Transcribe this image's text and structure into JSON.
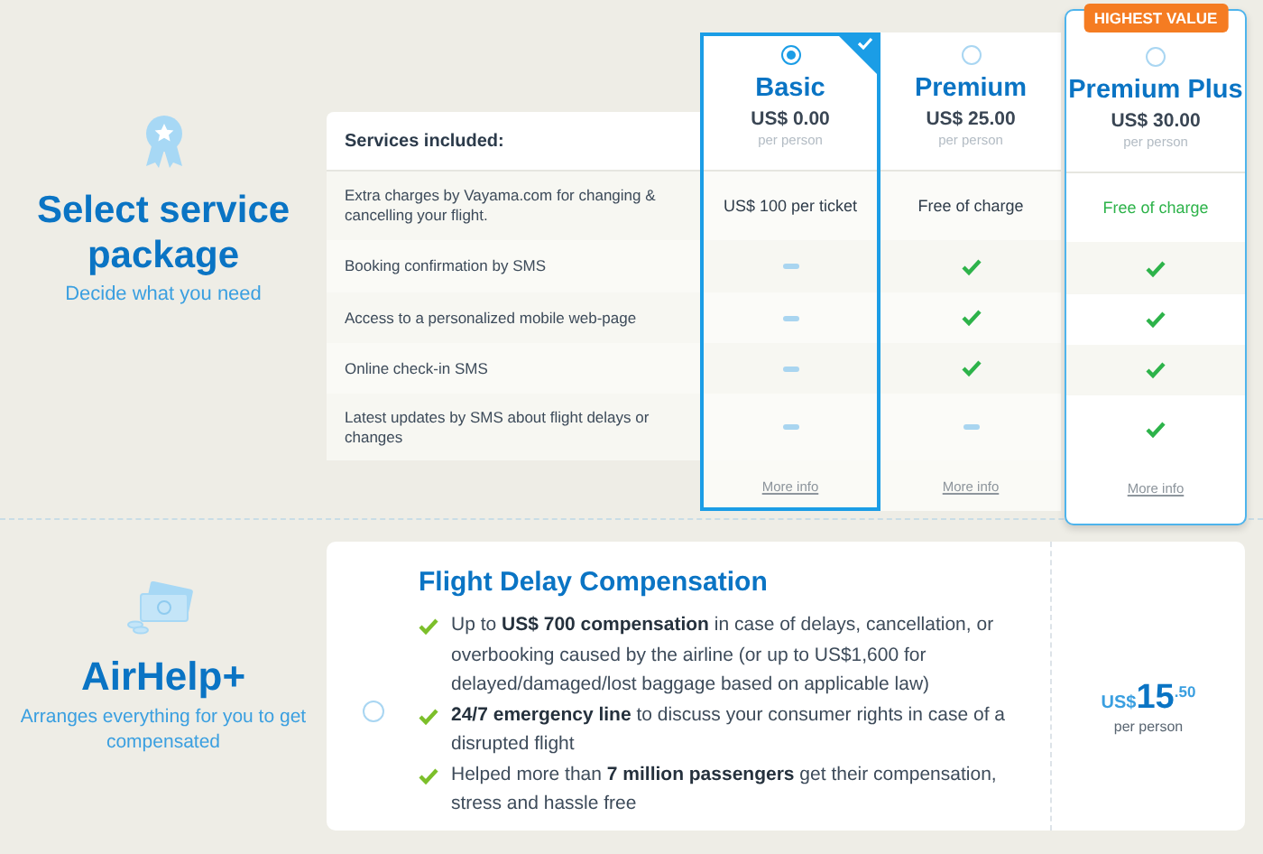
{
  "intro": {
    "title": "Select service package",
    "subtitle": "Decide what you need"
  },
  "services": {
    "heading": "Services included:",
    "rows": [
      "Extra charges by Vayama.com for changing & cancelling your flight.",
      "Booking confirmation by SMS",
      "Access to a personalized mobile web-page",
      "Online check-in SMS",
      "Latest updates by SMS about flight delays or changes"
    ]
  },
  "plans": [
    {
      "name": "Basic",
      "price": "US$ 0.00",
      "per": "per person",
      "selected": true,
      "more": "More info",
      "cells": [
        {
          "kind": "text",
          "text": "US$ 100 per ticket"
        },
        {
          "kind": "dash"
        },
        {
          "kind": "dash"
        },
        {
          "kind": "dash"
        },
        {
          "kind": "dash"
        }
      ]
    },
    {
      "name": "Premium",
      "price": "US$ 25.00",
      "per": "per person",
      "selected": false,
      "more": "More info",
      "cells": [
        {
          "kind": "text",
          "text": "Free of charge"
        },
        {
          "kind": "check"
        },
        {
          "kind": "check"
        },
        {
          "kind": "check"
        },
        {
          "kind": "dash"
        }
      ]
    },
    {
      "name": "Premium Plus",
      "price": "US$ 30.00",
      "per": "per person",
      "selected": false,
      "badge": "HIGHEST VALUE",
      "more": "More info",
      "cells": [
        {
          "kind": "highlight",
          "text": "Free of charge"
        },
        {
          "kind": "check"
        },
        {
          "kind": "check"
        },
        {
          "kind": "check"
        },
        {
          "kind": "check"
        }
      ]
    }
  ],
  "addon": {
    "title": "AirHelp+",
    "subtitle": "Arranges everything for you to get compensated",
    "offer": {
      "selected": false,
      "title": "Flight Delay Compensation",
      "bullets": [
        "Up to **US$ 700 compensation** in case of delays, cancellation, or overbooking caused by the airline (or up to US$1,600 for delayed/damaged/lost baggage based on applicable law)",
        "**24/7 emergency line** to discuss your consumer rights in case of a disrupted flight",
        "Helped more than **7 million passengers** get their compensation, stress and hassle free"
      ],
      "currency": "US$",
      "amount": "15",
      "cents": ".50",
      "per": "per person"
    }
  }
}
